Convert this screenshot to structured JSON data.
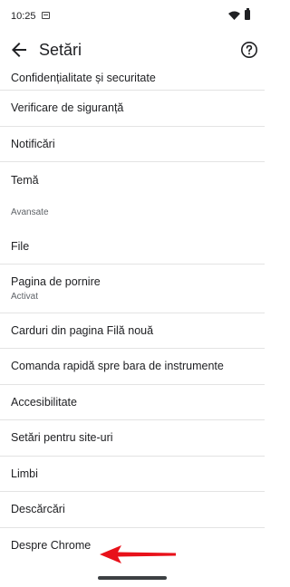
{
  "status": {
    "time": "10:25"
  },
  "header": {
    "title": "Setări"
  },
  "items": [
    {
      "label": "Confidențialitate și securitate"
    },
    {
      "label": "Verificare de siguranță"
    },
    {
      "label": "Notificări"
    },
    {
      "label": "Temă"
    }
  ],
  "section_advanced": "Avansate",
  "advanced_items": [
    {
      "label": "File"
    },
    {
      "label": "Pagina de pornire",
      "sub": "Activat"
    },
    {
      "label": "Carduri din pagina Filă nouă"
    },
    {
      "label": "Comanda rapidă spre bara de instrumente"
    },
    {
      "label": "Accesibilitate"
    },
    {
      "label": "Setări pentru site-uri"
    },
    {
      "label": "Limbi"
    },
    {
      "label": "Descărcări"
    },
    {
      "label": "Despre Chrome"
    }
  ],
  "colors": {
    "annotation_arrow": "#e8111a",
    "divider": "#e3e3e3"
  }
}
